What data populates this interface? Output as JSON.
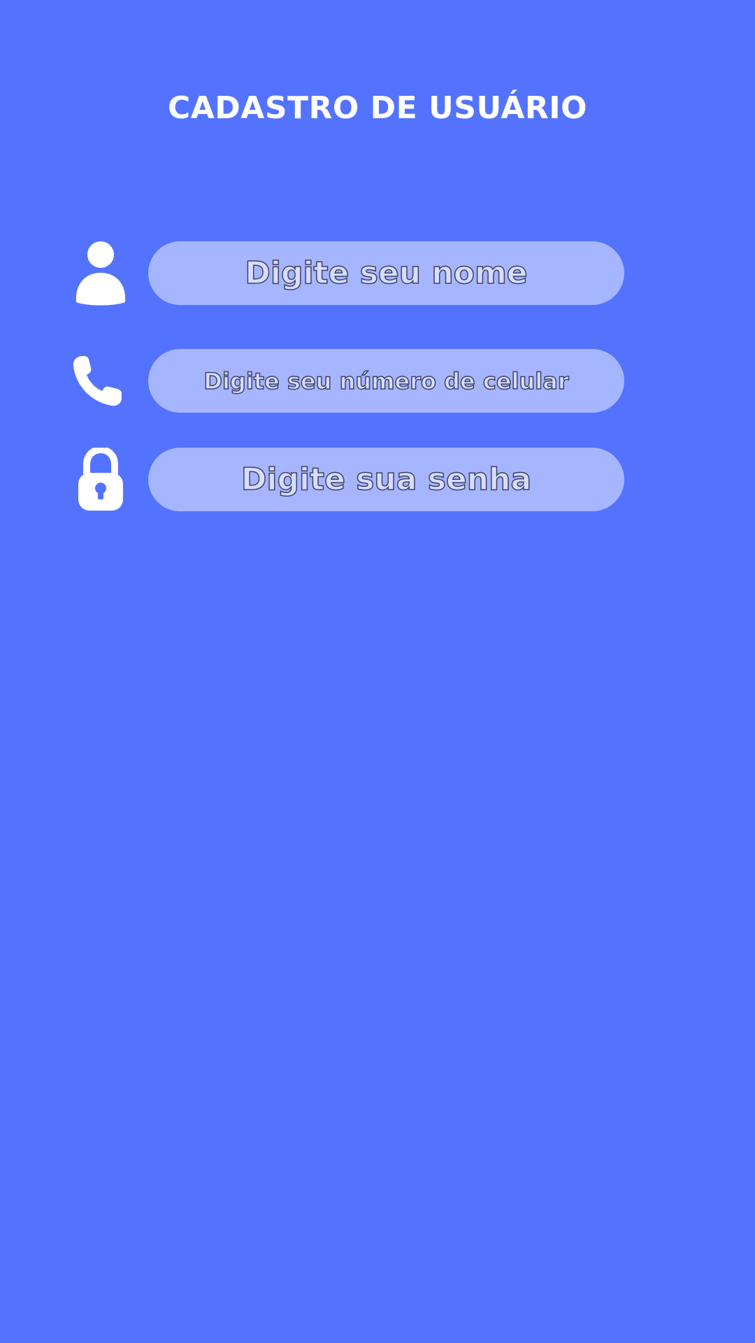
{
  "page": {
    "title": "CADASTRO DE USUÁRIO"
  },
  "form": {
    "name": {
      "icon": "person-icon",
      "placeholder": "Digite seu nome",
      "value": ""
    },
    "phone": {
      "icon": "phone-icon",
      "placeholder": "Digite seu número de celular",
      "value": ""
    },
    "password": {
      "icon": "lock-icon",
      "placeholder": "Digite sua senha",
      "value": ""
    }
  },
  "colors": {
    "background": "#5373ff",
    "field_background": "#a6b5ff",
    "title_text": "#ffffff",
    "placeholder_fill": "#d8dcff",
    "placeholder_outline": "#3d4366"
  }
}
